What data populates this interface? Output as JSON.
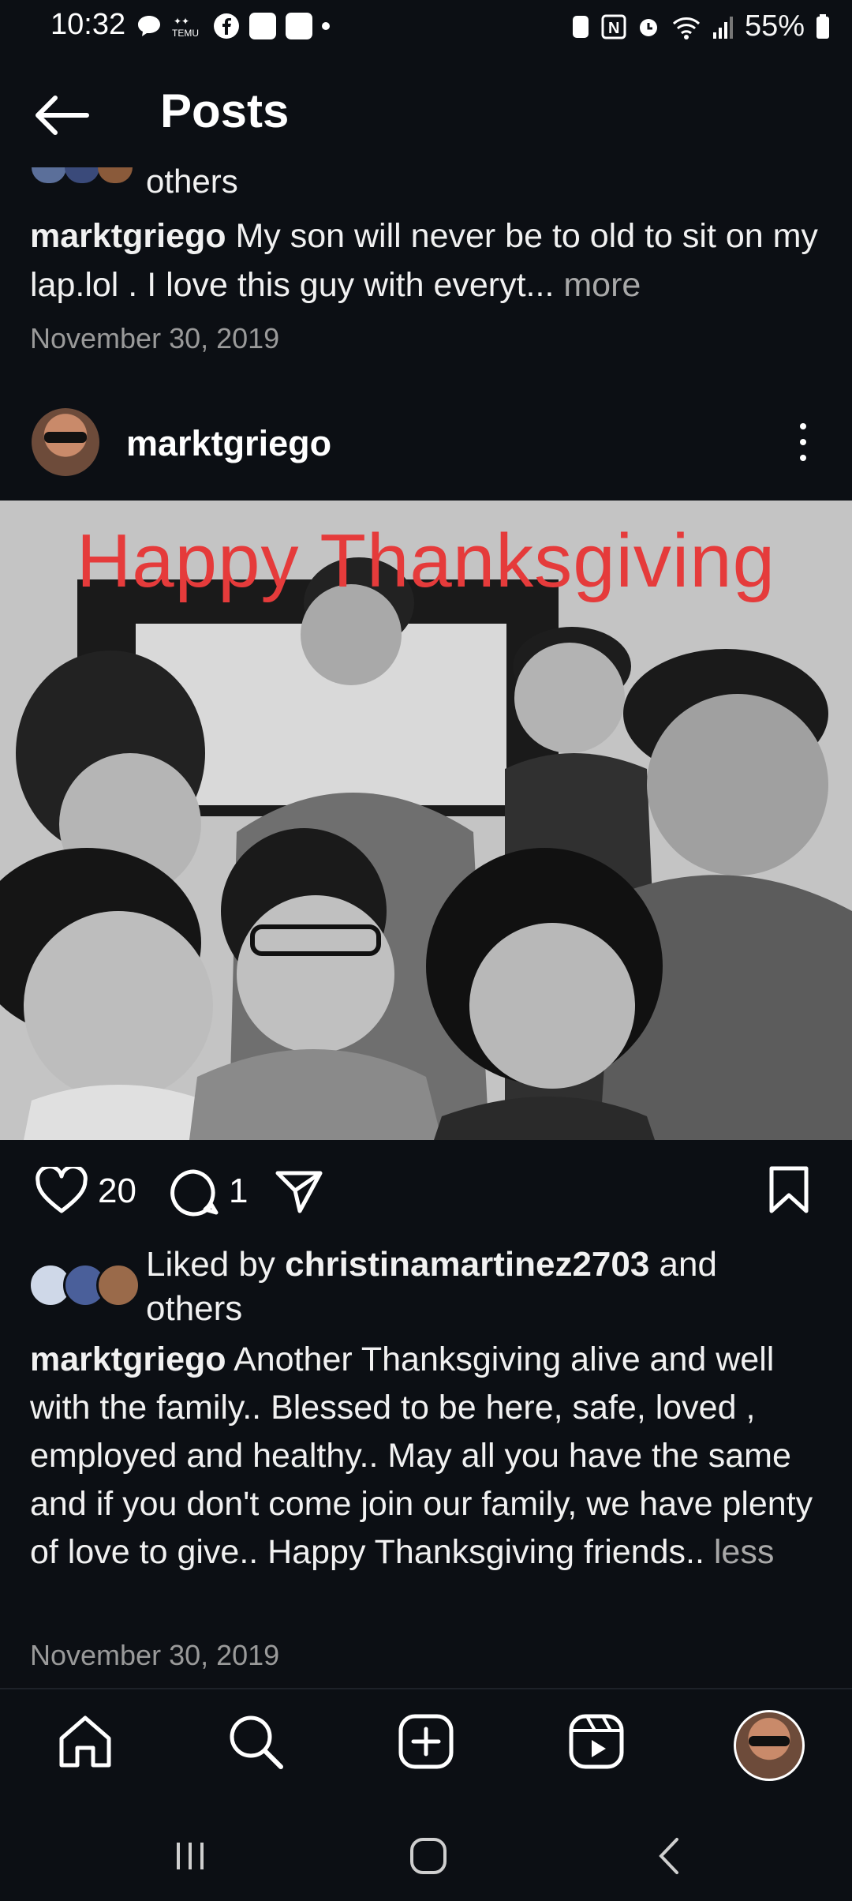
{
  "status_bar": {
    "time": "10:32",
    "battery": "55%",
    "left_icons": [
      "chat-bubble-icon",
      "temu-icon",
      "facebook-icon",
      "messenger-icon",
      "app-icon",
      "dot-icon"
    ],
    "right_icons": [
      "nfc-icon",
      "n-icon",
      "alarm-icon",
      "wifi-icon",
      "signal-icon",
      "battery-icon"
    ]
  },
  "header": {
    "title": "Posts"
  },
  "prev_post": {
    "others_text": "others",
    "username": "marktgriego",
    "caption": " My son will never be to old to sit on my lap.lol . I love this guy with everyt...",
    "more_label": " more",
    "date": "November 30, 2019"
  },
  "post": {
    "username": "marktgriego",
    "photo_text": "Happy Thanksgiving",
    "likes_count": "20",
    "comments_count": "1",
    "liked_by_prefix": "Liked by ",
    "liked_by_user": "christinamartinez2703",
    "liked_by_suffix": " and",
    "liked_by_others": "others",
    "caption_username": "marktgriego",
    "caption": " Another Thanksgiving alive and well with the family.. Blessed to be here, safe, loved , employed and healthy.. May all you have the same and if you don't come join our family, we have plenty of love to give.. Happy Thanksgiving friends..",
    "less_label": " less",
    "date": "November 30, 2019"
  },
  "colors": {
    "background": "#0c0f14",
    "photo_text": "#e53b3b",
    "muted": "#a8a8a8"
  }
}
